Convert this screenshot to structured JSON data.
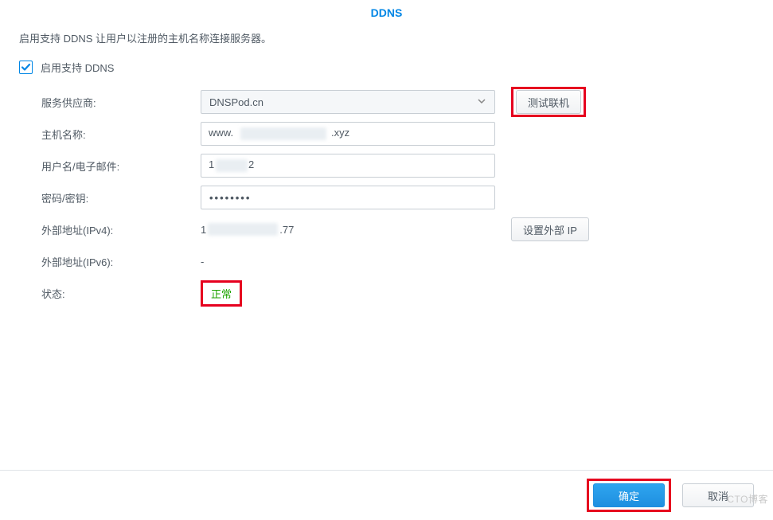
{
  "title": "DDNS",
  "description": "启用支持 DDNS 让用户以注册的主机名称连接服务器。",
  "enable": {
    "label": "启用支持 DDNS",
    "checked": true
  },
  "form": {
    "provider": {
      "label": "服务供应商:",
      "value": "DNSPod.cn"
    },
    "hostname": {
      "label": "主机名称:",
      "prefix": "www.",
      "suffix": ".xyz"
    },
    "username": {
      "label": "用户名/电子邮件:",
      "prefix": "1",
      "suffix": "2"
    },
    "password": {
      "label": "密码/密钥:",
      "value": "••••••••"
    },
    "ipv4": {
      "label": "外部地址(IPv4):",
      "prefix": "1",
      "suffix": ".77"
    },
    "ipv6": {
      "label": "外部地址(IPv6):",
      "value": "-"
    },
    "status": {
      "label": "状态:",
      "value": "正常"
    }
  },
  "buttons": {
    "test_connection": "测试联机",
    "set_external_ip": "设置外部 IP",
    "ok": "确定",
    "cancel": "取消"
  },
  "watermark": "CTO博客"
}
